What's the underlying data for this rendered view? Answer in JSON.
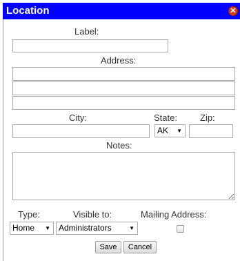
{
  "dialog": {
    "title": "Location",
    "close_icon": "close-icon"
  },
  "form": {
    "label_label": "Label:",
    "label_value": "",
    "address_label": "Address:",
    "address_line1": "",
    "address_line2": "",
    "address_line3": "",
    "city_label": "City:",
    "city_value": "",
    "state_label": "State:",
    "state_value": "AK",
    "zip_label": "Zip:",
    "zip_value": "",
    "notes_label": "Notes:",
    "notes_value": "",
    "type_label": "Type:",
    "type_value": "Home",
    "visible_label": "Visible to:",
    "visible_value": "Administrators",
    "mailing_label": "Mailing Address:",
    "mailing_checked": false
  },
  "buttons": {
    "save": "Save",
    "cancel": "Cancel"
  },
  "colors": {
    "titlebar": "#0000ff",
    "close": "#d63a1a"
  }
}
